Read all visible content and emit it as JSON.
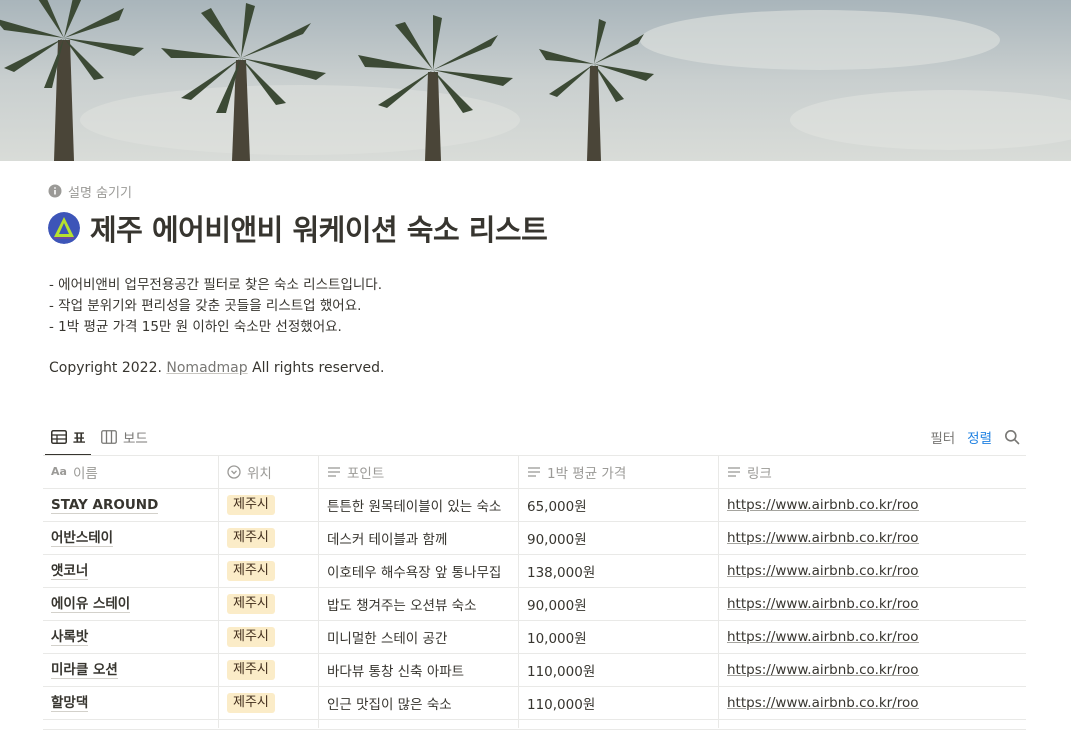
{
  "page": {
    "toggle_label": "설명 숨기기",
    "title": "제주 에어비앤비 워케이션 숙소 리스트",
    "description": [
      "- 에어비앤비 업무전용공간 필터로 찾은 숙소 리스트입니다.",
      "- 작업 분위기와 편리성을 갖춘 곳들을 리스트업 했어요.",
      "- 1박 평균 가격 15만 원 이하인 숙소만 선정했어요."
    ],
    "copyright_prefix": "Copyright 2022.",
    "copyright_link": "Nomadmap",
    "copyright_suffix": "All rights reserved."
  },
  "views": {
    "tabs": [
      {
        "label": "표",
        "icon": "table-icon",
        "active": true
      },
      {
        "label": "보드",
        "icon": "board-icon",
        "active": false
      }
    ],
    "filter_label": "필터",
    "sort_label": "정렬",
    "sort_color": "#2383e2"
  },
  "table": {
    "columns": [
      {
        "label": "이름",
        "icon": "Aa"
      },
      {
        "label": "위치",
        "icon": "select-icon"
      },
      {
        "label": "포인트",
        "icon": "text-icon"
      },
      {
        "label": "1박 평균 가격",
        "icon": "text-icon"
      },
      {
        "label": "링크",
        "icon": "text-icon"
      }
    ],
    "rows": [
      {
        "name": "STAY AROUND",
        "location": "제주시",
        "point": "튼튼한 원목테이블이 있는 숙소",
        "price": "65,000원",
        "link": "https://www.airbnb.co.kr/room"
      },
      {
        "name": "어반스테이",
        "location": "제주시",
        "point": "데스커 테이블과 함께",
        "price": "90,000원",
        "link": "https://www.airbnb.co.kr/room"
      },
      {
        "name": "앳코너",
        "location": "제주시",
        "point": "이호테우 해수욕장 앞 통나무집",
        "price": "138,000원",
        "link": "https://www.airbnb.co.kr/room"
      },
      {
        "name": "에이유 스테이",
        "location": "제주시",
        "point": "밥도 챙겨주는 오션뷰 숙소",
        "price": "90,000원",
        "link": "https://www.airbnb.co.kr/room"
      },
      {
        "name": "사록밧",
        "location": "제주시",
        "point": "미니멀한 스테이 공간",
        "price": "10,000원",
        "link": "https://www.airbnb.co.kr/room"
      },
      {
        "name": "미라클 오션",
        "location": "제주시",
        "point": "바다뷰 통창 신축 아파트",
        "price": "110,000원",
        "link": "https://www.airbnb.co.kr/room"
      },
      {
        "name": "할망댁",
        "location": "제주시",
        "point": "인근 맛집이 많은 숙소",
        "price": "110,000원",
        "link": "https://www.airbnb.co.kr/room"
      }
    ],
    "tag_color": "#fbecc8"
  }
}
